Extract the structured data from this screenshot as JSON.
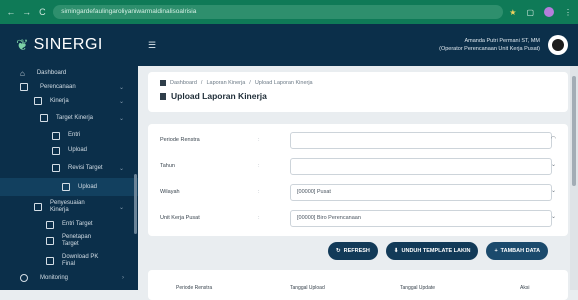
{
  "browser": {
    "back": "←",
    "forward": "→",
    "reload": "C",
    "url": "simingardefaulingaroliyaniwarmaldinalisoalrisia"
  },
  "app": {
    "brand": "SINERGI"
  },
  "user": {
    "name": "Amanda Putri Permani ST, MM",
    "role": "(Operator Perencanaan Unit Kerja Pusat)"
  },
  "sidebar": {
    "items": [
      {
        "label": "Dashboard"
      },
      {
        "label": "Perencanaan"
      },
      {
        "label": "Kinerja"
      },
      {
        "label": "Target Kinerja"
      },
      {
        "label": "Entri"
      },
      {
        "label": "Upload"
      },
      {
        "label": "Revisi Target"
      },
      {
        "label": "Upload"
      },
      {
        "label": "Penyesuaian Kinerja"
      },
      {
        "label": "Entri Target"
      },
      {
        "label": "Penetapan Target"
      },
      {
        "label": "Download PK Final"
      },
      {
        "label": "Monitoring"
      }
    ]
  },
  "breadcrumb": {
    "home": "Dashboard",
    "level1": "Laporan Kinerja",
    "level2": "Upload Laporan Kinerja"
  },
  "page": {
    "title": "Upload Laporan Kinerja"
  },
  "form": {
    "periode": {
      "label": "Periode Renstra",
      "value": ""
    },
    "tahun": {
      "label": "Tahun",
      "value": ""
    },
    "wilayah": {
      "label": "Wilayah",
      "value": "[00000] Pusat"
    },
    "unit": {
      "label": "Unit Kerja Pusat",
      "value": "[00000] Biro Perencanaan"
    }
  },
  "actions": {
    "refresh": "REFRESH",
    "download": "UNDUH TEMPLATE LAKIN",
    "add": "TAMBAH DATA"
  },
  "table": {
    "columns": [
      "Periode Renstra",
      "Tanggal Upload",
      "Tanggal Update",
      "Aksi"
    ]
  }
}
